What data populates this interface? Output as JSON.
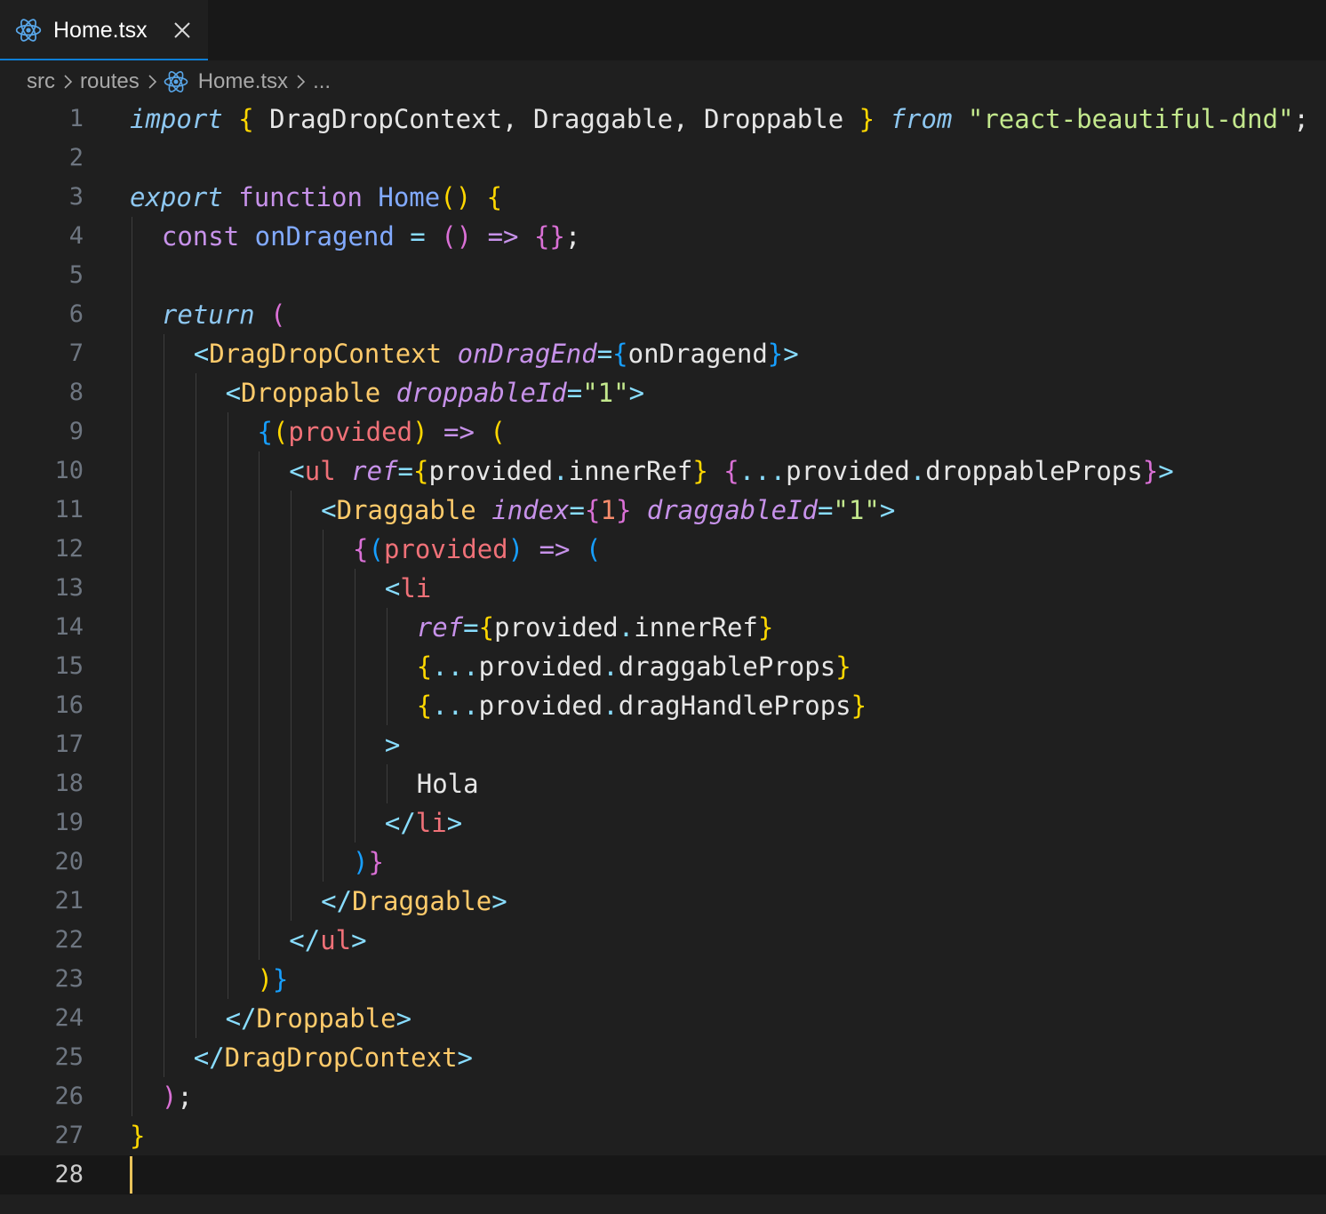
{
  "tab": {
    "label": "Home.tsx",
    "icon": "react-icon"
  },
  "breadcrumb": {
    "items": [
      "src",
      "routes",
      "Home.tsx",
      "..."
    ]
  },
  "editor": {
    "active_line": 28,
    "lines": [
      {
        "n": "1",
        "indent": 0,
        "tokens": [
          [
            "kw-it",
            "import"
          ],
          [
            "var",
            " "
          ],
          [
            "b1",
            "{"
          ],
          [
            "var",
            " DragDropContext, Draggable, Droppable "
          ],
          [
            "b1",
            "}"
          ],
          [
            "var",
            " "
          ],
          [
            "kw-it",
            "from"
          ],
          [
            "var",
            " "
          ],
          [
            "str",
            "\"react-beautiful-dnd\""
          ],
          [
            "var",
            ";"
          ]
        ]
      },
      {
        "n": "2",
        "indent": 0,
        "tokens": []
      },
      {
        "n": "3",
        "indent": 0,
        "tokens": [
          [
            "kw-it",
            "export"
          ],
          [
            "var",
            " "
          ],
          [
            "kw",
            "function"
          ],
          [
            "var",
            " "
          ],
          [
            "fn",
            "Home"
          ],
          [
            "b1",
            "()"
          ],
          [
            "var",
            " "
          ],
          [
            "b1",
            "{"
          ]
        ]
      },
      {
        "n": "4",
        "indent": 1,
        "tokens": [
          [
            "kw",
            "const"
          ],
          [
            "var",
            " "
          ],
          [
            "fn",
            "onDragend"
          ],
          [
            "var",
            " "
          ],
          [
            "op",
            "="
          ],
          [
            "var",
            " "
          ],
          [
            "b2",
            "()"
          ],
          [
            "var",
            " "
          ],
          [
            "kw",
            "=>"
          ],
          [
            "var",
            " "
          ],
          [
            "b2",
            "{}"
          ],
          [
            "var",
            ";"
          ]
        ]
      },
      {
        "n": "5",
        "indent": 0,
        "tokens": []
      },
      {
        "n": "6",
        "indent": 1,
        "tokens": [
          [
            "kw-it",
            "return"
          ],
          [
            "var",
            " "
          ],
          [
            "b2",
            "("
          ]
        ]
      },
      {
        "n": "7",
        "indent": 2,
        "tokens": [
          [
            "punct",
            "<"
          ],
          [
            "tag",
            "DragDropContext"
          ],
          [
            "var",
            " "
          ],
          [
            "attr",
            "onDragEnd"
          ],
          [
            "op",
            "="
          ],
          [
            "b3",
            "{"
          ],
          [
            "var",
            "onDragend"
          ],
          [
            "b3",
            "}"
          ],
          [
            "punct",
            ">"
          ]
        ]
      },
      {
        "n": "8",
        "indent": 3,
        "tokens": [
          [
            "punct",
            "<"
          ],
          [
            "tag",
            "Droppable"
          ],
          [
            "var",
            " "
          ],
          [
            "attr",
            "droppableId"
          ],
          [
            "op",
            "="
          ],
          [
            "str",
            "\"1\""
          ],
          [
            "punct",
            ">"
          ]
        ]
      },
      {
        "n": "9",
        "indent": 4,
        "tokens": [
          [
            "b3",
            "{"
          ],
          [
            "b1",
            "("
          ],
          [
            "param",
            "provided"
          ],
          [
            "b1",
            ")"
          ],
          [
            "var",
            " "
          ],
          [
            "kw",
            "=>"
          ],
          [
            "var",
            " "
          ],
          [
            "b1",
            "("
          ]
        ]
      },
      {
        "n": "10",
        "indent": 5,
        "tokens": [
          [
            "punct",
            "<"
          ],
          [
            "tag-html",
            "ul"
          ],
          [
            "var",
            " "
          ],
          [
            "attr",
            "ref"
          ],
          [
            "op",
            "="
          ],
          [
            "b1",
            "{"
          ],
          [
            "var",
            "provided"
          ],
          [
            "op",
            "."
          ],
          [
            "var",
            "innerRef"
          ],
          [
            "b1",
            "}"
          ],
          [
            "var",
            " "
          ],
          [
            "b2",
            "{"
          ],
          [
            "op",
            "..."
          ],
          [
            "var",
            "provided"
          ],
          [
            "op",
            "."
          ],
          [
            "var",
            "droppableProps"
          ],
          [
            "b2",
            "}"
          ],
          [
            "punct",
            ">"
          ]
        ]
      },
      {
        "n": "11",
        "indent": 6,
        "tokens": [
          [
            "punct",
            "<"
          ],
          [
            "tag",
            "Draggable"
          ],
          [
            "var",
            " "
          ],
          [
            "attr",
            "index"
          ],
          [
            "op",
            "="
          ],
          [
            "b2",
            "{"
          ],
          [
            "num",
            "1"
          ],
          [
            "b2",
            "}"
          ],
          [
            "var",
            " "
          ],
          [
            "attr",
            "draggableId"
          ],
          [
            "op",
            "="
          ],
          [
            "str",
            "\"1\""
          ],
          [
            "punct",
            ">"
          ]
        ]
      },
      {
        "n": "12",
        "indent": 7,
        "tokens": [
          [
            "b2",
            "{"
          ],
          [
            "b3",
            "("
          ],
          [
            "param",
            "provided"
          ],
          [
            "b3",
            ")"
          ],
          [
            "var",
            " "
          ],
          [
            "kw",
            "=>"
          ],
          [
            "var",
            " "
          ],
          [
            "b3",
            "("
          ]
        ]
      },
      {
        "n": "13",
        "indent": 8,
        "tokens": [
          [
            "punct",
            "<"
          ],
          [
            "tag-html",
            "li"
          ]
        ]
      },
      {
        "n": "14",
        "indent": 9,
        "tokens": [
          [
            "attr",
            "ref"
          ],
          [
            "op",
            "="
          ],
          [
            "b1",
            "{"
          ],
          [
            "var",
            "provided"
          ],
          [
            "op",
            "."
          ],
          [
            "var",
            "innerRef"
          ],
          [
            "b1",
            "}"
          ]
        ]
      },
      {
        "n": "15",
        "indent": 9,
        "tokens": [
          [
            "b1",
            "{"
          ],
          [
            "op",
            "..."
          ],
          [
            "var",
            "provided"
          ],
          [
            "op",
            "."
          ],
          [
            "var",
            "draggableProps"
          ],
          [
            "b1",
            "}"
          ]
        ]
      },
      {
        "n": "16",
        "indent": 9,
        "tokens": [
          [
            "b1",
            "{"
          ],
          [
            "op",
            "..."
          ],
          [
            "var",
            "provided"
          ],
          [
            "op",
            "."
          ],
          [
            "var",
            "dragHandleProps"
          ],
          [
            "b1",
            "}"
          ]
        ]
      },
      {
        "n": "17",
        "indent": 8,
        "tokens": [
          [
            "punct",
            ">"
          ]
        ]
      },
      {
        "n": "18",
        "indent": 9,
        "tokens": [
          [
            "var",
            "Hola"
          ]
        ]
      },
      {
        "n": "19",
        "indent": 8,
        "tokens": [
          [
            "punct",
            "</"
          ],
          [
            "tag-html",
            "li"
          ],
          [
            "punct",
            ">"
          ]
        ]
      },
      {
        "n": "20",
        "indent": 7,
        "tokens": [
          [
            "b3",
            ")"
          ],
          [
            "b2",
            "}"
          ]
        ]
      },
      {
        "n": "21",
        "indent": 6,
        "tokens": [
          [
            "punct",
            "</"
          ],
          [
            "tag",
            "Draggable"
          ],
          [
            "punct",
            ">"
          ]
        ]
      },
      {
        "n": "22",
        "indent": 5,
        "tokens": [
          [
            "punct",
            "</"
          ],
          [
            "tag-html",
            "ul"
          ],
          [
            "punct",
            ">"
          ]
        ]
      },
      {
        "n": "23",
        "indent": 4,
        "tokens": [
          [
            "b1",
            ")"
          ],
          [
            "b3",
            "}"
          ]
        ]
      },
      {
        "n": "24",
        "indent": 3,
        "tokens": [
          [
            "punct",
            "</"
          ],
          [
            "tag",
            "Droppable"
          ],
          [
            "punct",
            ">"
          ]
        ]
      },
      {
        "n": "25",
        "indent": 2,
        "tokens": [
          [
            "punct",
            "</"
          ],
          [
            "tag",
            "DragDropContext"
          ],
          [
            "punct",
            ">"
          ]
        ]
      },
      {
        "n": "26",
        "indent": 1,
        "tokens": [
          [
            "b2",
            ")"
          ],
          [
            "var",
            ";"
          ]
        ]
      },
      {
        "n": "27",
        "indent": 0,
        "tokens": [
          [
            "b1",
            "}"
          ]
        ]
      },
      {
        "n": "28",
        "indent": 0,
        "tokens": []
      }
    ]
  }
}
